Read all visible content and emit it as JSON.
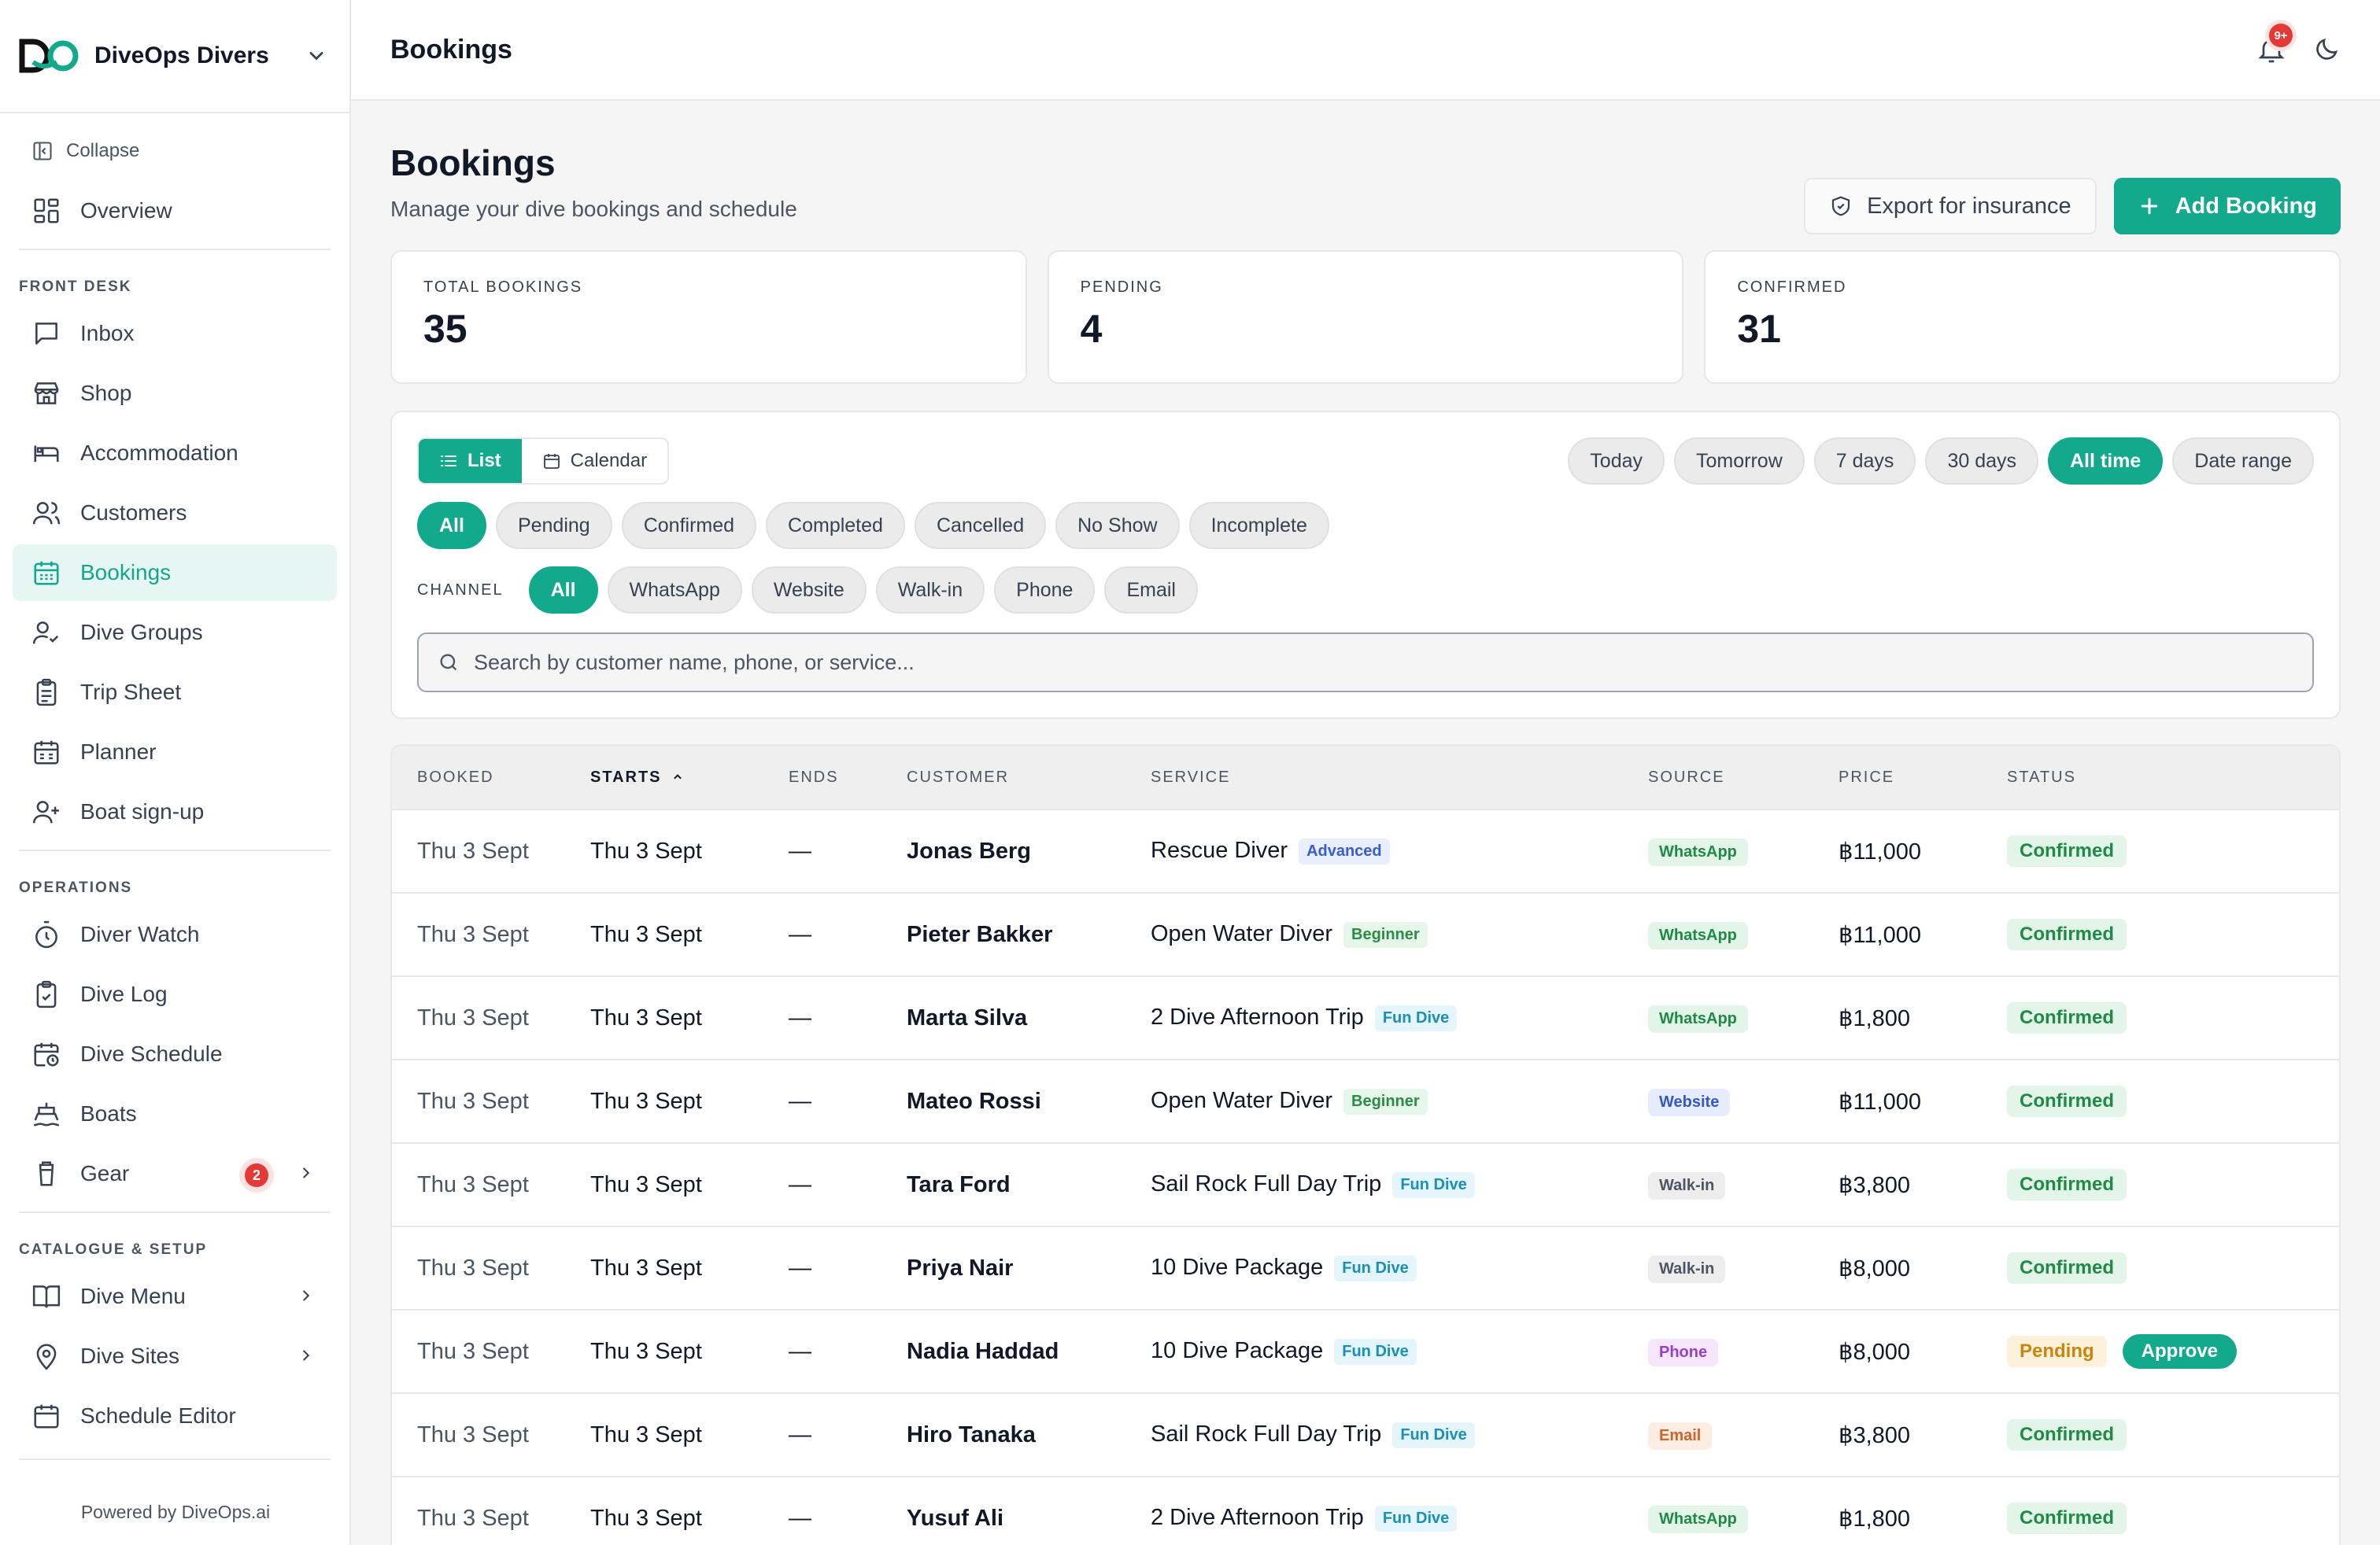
{
  "brand": {
    "name": "DiveOps Divers",
    "logo_text": "DO"
  },
  "sidebar": {
    "collapse_label": "Collapse",
    "overview_label": "Overview",
    "sections": [
      {
        "label": "FRONT DESK",
        "items": [
          "Inbox",
          "Shop",
          "Accommodation",
          "Customers",
          "Bookings",
          "Dive Groups",
          "Trip Sheet",
          "Planner",
          "Boat sign-up"
        ]
      },
      {
        "label": "OPERATIONS",
        "items": [
          "Diver Watch",
          "Dive Log",
          "Dive Schedule",
          "Boats",
          "Gear"
        ]
      },
      {
        "label": "CATALOGUE & SETUP",
        "items": [
          "Dive Menu",
          "Dive Sites",
          "Schedule Editor"
        ]
      }
    ],
    "gear_badge": "2",
    "powered_by": "Powered by DiveOps.ai"
  },
  "topbar": {
    "title": "Bookings",
    "notif_badge": "9+"
  },
  "page": {
    "title": "Bookings",
    "subtitle": "Manage your dive bookings and schedule",
    "export_label": "Export for insurance",
    "add_label": "Add Booking"
  },
  "stats": [
    {
      "label": "TOTAL BOOKINGS",
      "value": "35"
    },
    {
      "label": "PENDING",
      "value": "4"
    },
    {
      "label": "CONFIRMED",
      "value": "31"
    }
  ],
  "filters": {
    "view_list": "List",
    "view_calendar": "Calendar",
    "ranges": [
      "Today",
      "Tomorrow",
      "7 days",
      "30 days",
      "All time",
      "Date range"
    ],
    "active_range": "All time",
    "statuses": [
      "All",
      "Pending",
      "Confirmed",
      "Completed",
      "Cancelled",
      "No Show",
      "Incomplete"
    ],
    "channel_label": "CHANNEL",
    "channels": [
      "All",
      "WhatsApp",
      "Website",
      "Walk-in",
      "Phone",
      "Email"
    ],
    "search_placeholder": "Search by customer name, phone, or service..."
  },
  "table": {
    "columns": [
      "BOOKED",
      "STARTS",
      "ENDS",
      "CUSTOMER",
      "SERVICE",
      "SOURCE",
      "PRICE",
      "STATUS"
    ],
    "approve_label": "Approve",
    "rows": [
      {
        "booked": "Thu 3 Sept",
        "starts": "Thu 3 Sept",
        "ends": "—",
        "customer": "Jonas Berg",
        "service": "Rescue Diver",
        "tag": "Advanced",
        "source": "WhatsApp",
        "price": "฿11,000",
        "status": "Confirmed"
      },
      {
        "booked": "Thu 3 Sept",
        "starts": "Thu 3 Sept",
        "ends": "—",
        "customer": "Pieter Bakker",
        "service": "Open Water Diver",
        "tag": "Beginner",
        "source": "WhatsApp",
        "price": "฿11,000",
        "status": "Confirmed"
      },
      {
        "booked": "Thu 3 Sept",
        "starts": "Thu 3 Sept",
        "ends": "—",
        "customer": "Marta Silva",
        "service": "2 Dive Afternoon Trip",
        "tag": "Fun Dive",
        "source": "WhatsApp",
        "price": "฿1,800",
        "status": "Confirmed"
      },
      {
        "booked": "Thu 3 Sept",
        "starts": "Thu 3 Sept",
        "ends": "—",
        "customer": "Mateo Rossi",
        "service": "Open Water Diver",
        "tag": "Beginner",
        "source": "Website",
        "price": "฿11,000",
        "status": "Confirmed"
      },
      {
        "booked": "Thu 3 Sept",
        "starts": "Thu 3 Sept",
        "ends": "—",
        "customer": "Tara Ford",
        "service": "Sail Rock Full Day Trip",
        "tag": "Fun Dive",
        "source": "Walk-in",
        "price": "฿3,800",
        "status": "Confirmed"
      },
      {
        "booked": "Thu 3 Sept",
        "starts": "Thu 3 Sept",
        "ends": "—",
        "customer": "Priya Nair",
        "service": "10 Dive Package",
        "tag": "Fun Dive",
        "source": "Walk-in",
        "price": "฿8,000",
        "status": "Confirmed"
      },
      {
        "booked": "Thu 3 Sept",
        "starts": "Thu 3 Sept",
        "ends": "—",
        "customer": "Nadia Haddad",
        "service": "10 Dive Package",
        "tag": "Fun Dive",
        "source": "Phone",
        "price": "฿8,000",
        "status": "Pending"
      },
      {
        "booked": "Thu 3 Sept",
        "starts": "Thu 3 Sept",
        "ends": "—",
        "customer": "Hiro Tanaka",
        "service": "Sail Rock Full Day Trip",
        "tag": "Fun Dive",
        "source": "Email",
        "price": "฿3,800",
        "status": "Confirmed"
      },
      {
        "booked": "Thu 3 Sept",
        "starts": "Thu 3 Sept",
        "ends": "—",
        "customer": "Yusuf Ali",
        "service": "2 Dive Afternoon Trip",
        "tag": "Fun Dive",
        "source": "WhatsApp",
        "price": "฿1,800",
        "status": "Confirmed"
      }
    ]
  },
  "colors": {
    "accent": "#12a98d",
    "tag_advanced": "#e8eefc",
    "tag_beginner": "#e6f6ea",
    "tag_fundive": "#e4f5fb",
    "src_whatsapp": "#e3f5e8",
    "src_website": "#e6ecfb",
    "src_walkin": "#ededed",
    "src_phone": "#f5e6fb",
    "src_email": "#fdece2",
    "status_confirmed": "#e3f5e8",
    "status_pending": "#fdf1dc"
  },
  "icons": {
    "nav": [
      "inbox-icon",
      "shop-icon",
      "bed-icon",
      "users-icon",
      "calendar-icon",
      "dive-groups-icon",
      "clipboard-icon",
      "planner-icon",
      "user-plus-icon",
      "stopwatch-icon",
      "log-icon",
      "schedule-icon",
      "boat-icon",
      "tank-icon",
      "book-icon",
      "map-pin-icon",
      "calendar-edit-icon"
    ]
  }
}
